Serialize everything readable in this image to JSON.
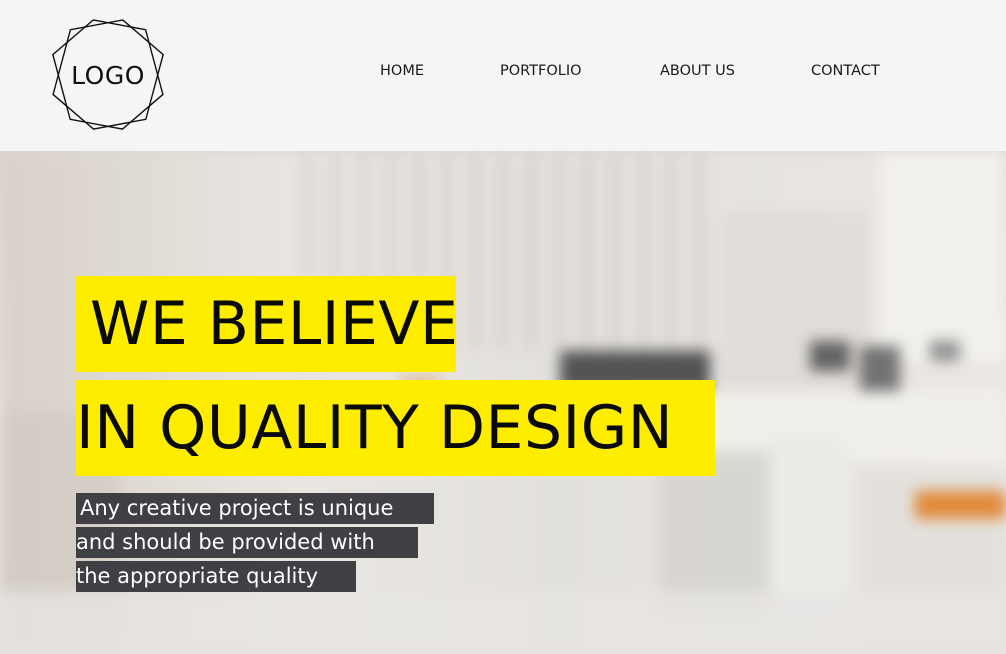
{
  "header": {
    "logo_text": "LOGO",
    "nav": {
      "home": "HOME",
      "portfolio": "PORTFOLIO",
      "about": "ABOUT US",
      "contact": "CONTACT"
    }
  },
  "hero": {
    "headline_line_1": "WE BELIEVE",
    "headline_line_2": "IN QUALITY DESIGN",
    "subtext_line_1": "Any creative project is unique",
    "subtext_line_2": "and should be provided with",
    "subtext_line_3": "the appropriate quality"
  },
  "colors": {
    "header_background": "#f5f5f5",
    "headline_highlight": "#ffed00",
    "subtext_highlight": "#3f3f44",
    "text_dark": "#0a0a0a",
    "text_light": "#ffffff"
  },
  "icons": {
    "logo": "octagon-star-logo-icon"
  }
}
